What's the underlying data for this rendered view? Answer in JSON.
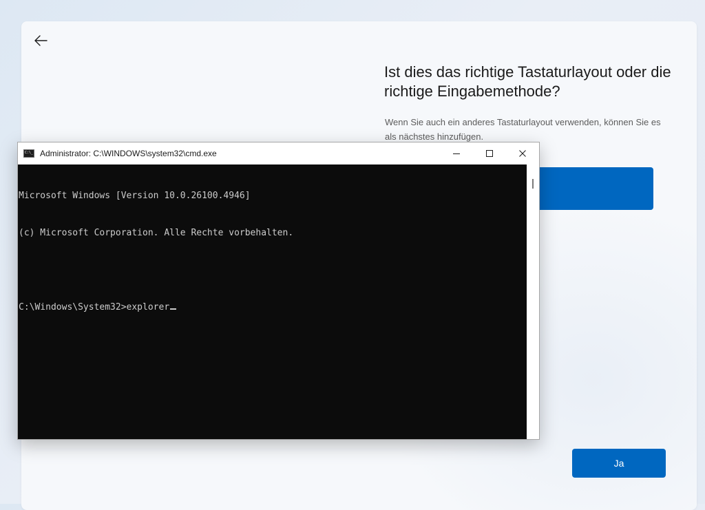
{
  "oobe": {
    "heading": "Ist dies das richtige Tastaturlayout oder die richtige Eingabemethode?",
    "subtext": "Wenn Sie auch ein anderes Tastaturlayout verwenden, können Sie es als nächstes hinzufügen.",
    "yes_button": "Ja",
    "accent_color": "#0067c0"
  },
  "cmd": {
    "title": "Administrator: C:\\WINDOWS\\system32\\cmd.exe",
    "lines": [
      "Microsoft Windows [Version 10.0.26100.4946]",
      "(c) Microsoft Corporation. Alle Rechte vorbehalten.",
      "",
      "C:\\Windows\\System32>explorer"
    ]
  }
}
